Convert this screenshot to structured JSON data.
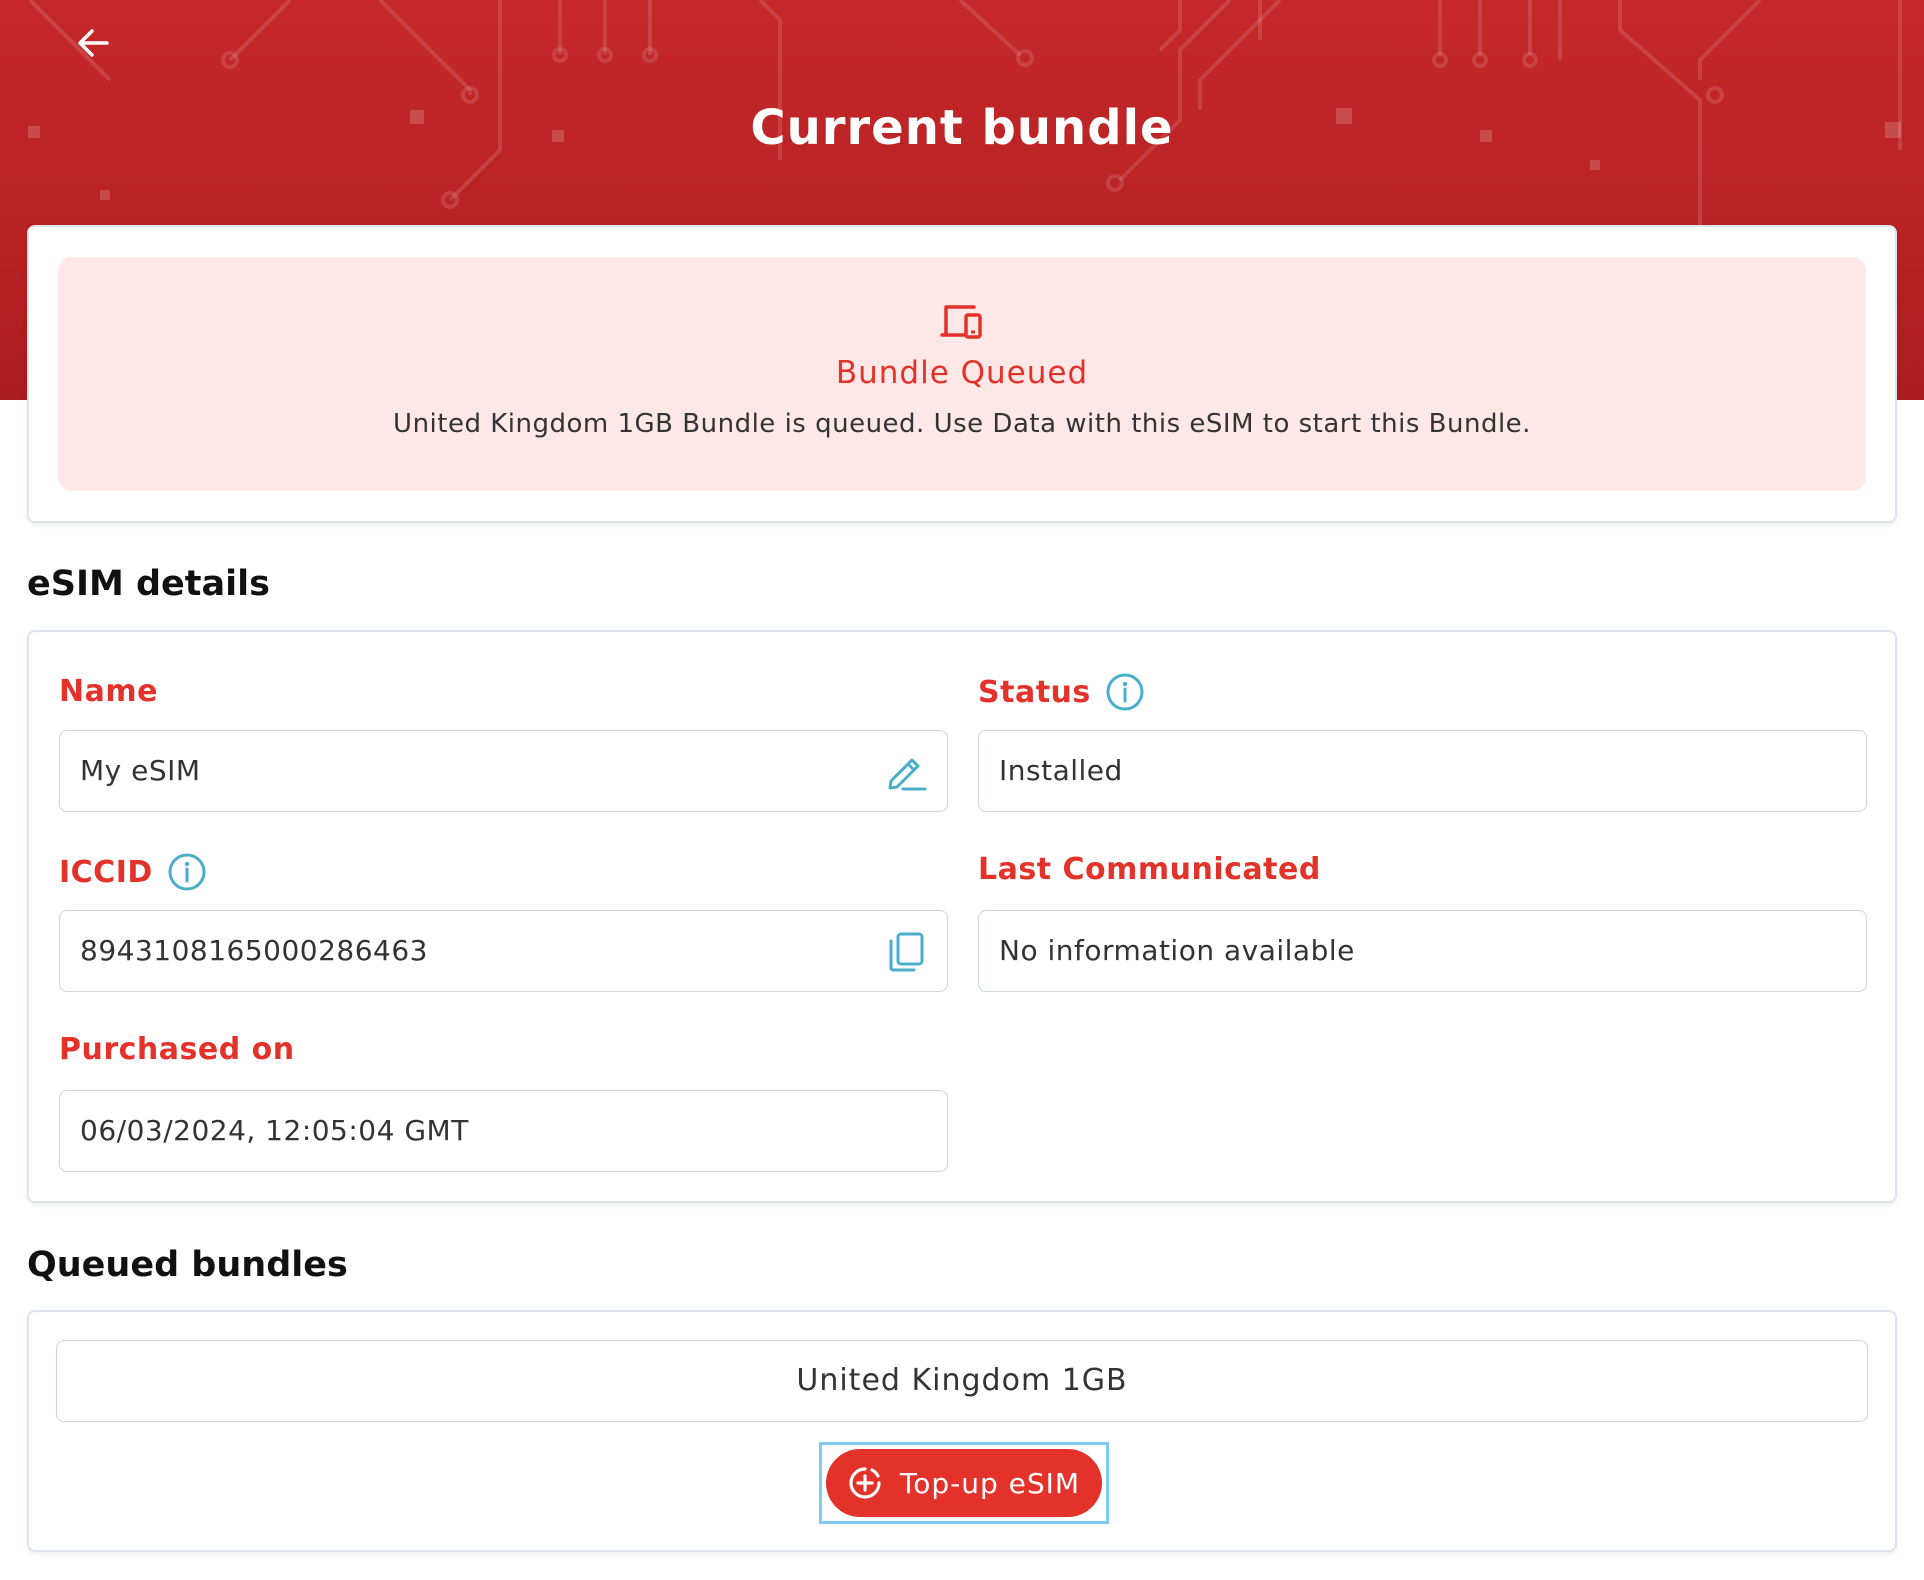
{
  "header": {
    "title": "Current bundle",
    "back_icon": "arrow-left-icon",
    "background_color": "#b82224"
  },
  "status_card": {
    "icon": "devices-icon",
    "title": "Bundle Queued",
    "message": "United Kingdom 1GB Bundle is queued. Use Data with this eSIM to start this Bundle.",
    "accent_color": "#e2322a",
    "background_color": "#fde8e7"
  },
  "esim_details": {
    "section_title": "eSIM details",
    "name": {
      "label": "Name",
      "value": "My eSIM",
      "action_icon": "edit-pencil-icon"
    },
    "status": {
      "label": "Status",
      "value": "Installed",
      "info_icon": "info-icon"
    },
    "iccid": {
      "label": "ICCID",
      "value": "8943108165000286463",
      "info_icon": "info-icon",
      "action_icon": "copy-icon"
    },
    "last_communicated": {
      "label": "Last Communicated",
      "value": "No information available"
    },
    "purchased_on": {
      "label": "Purchased on",
      "value": "06/03/2024, 12:05:04 GMT"
    },
    "label_color": "#e2322a",
    "icon_color": "#4aaecb"
  },
  "queued_bundles": {
    "section_title": "Queued bundles",
    "items": [
      {
        "name": "United Kingdom 1GB"
      }
    ],
    "topup_button": {
      "label": "Top-up eSIM",
      "icon": "add-circle-icon",
      "color": "#e2322a"
    }
  }
}
